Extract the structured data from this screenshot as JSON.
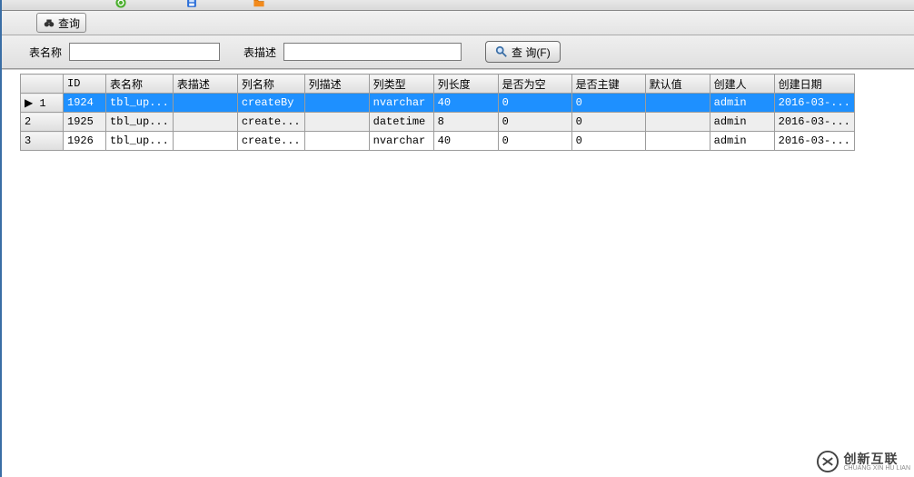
{
  "toolbar": {
    "query_label": "查询"
  },
  "filter": {
    "table_name_label": "表名称",
    "table_name_value": "",
    "table_desc_label": "表描述",
    "table_desc_value": "",
    "search_label": "查 询(F)"
  },
  "grid": {
    "columns": [
      "",
      "ID",
      "表名称",
      "表描述",
      "列名称",
      "列描述",
      "列类型",
      "列长度",
      "是否为空",
      "是否主键",
      "默认值",
      "创建人",
      "创建日期"
    ],
    "rows": [
      {
        "rownum": "1",
        "id": "1924",
        "table_name": "tbl_up...",
        "table_desc": "",
        "col_name": "createBy",
        "col_desc": "",
        "col_type": "nvarchar",
        "col_len": "40",
        "is_null": "0",
        "is_pk": "0",
        "def_val": "",
        "creator": "admin",
        "create_date": "2016-03-...",
        "selected": true,
        "even": false
      },
      {
        "rownum": "2",
        "id": "1925",
        "table_name": "tbl_up...",
        "table_desc": "",
        "col_name": "create...",
        "col_desc": "",
        "col_type": "datetime",
        "col_len": "8",
        "is_null": "0",
        "is_pk": "0",
        "def_val": "",
        "creator": "admin",
        "create_date": "2016-03-...",
        "selected": false,
        "even": true
      },
      {
        "rownum": "3",
        "id": "1926",
        "table_name": "tbl_up...",
        "table_desc": "",
        "col_name": "create...",
        "col_desc": "",
        "col_type": "nvarchar",
        "col_len": "40",
        "is_null": "0",
        "is_pk": "0",
        "def_val": "",
        "creator": "admin",
        "create_date": "2016-03-...",
        "selected": false,
        "even": false
      }
    ]
  },
  "watermark": {
    "main": "创新互联",
    "sub": "CHUANG XIN HU LIAN"
  }
}
